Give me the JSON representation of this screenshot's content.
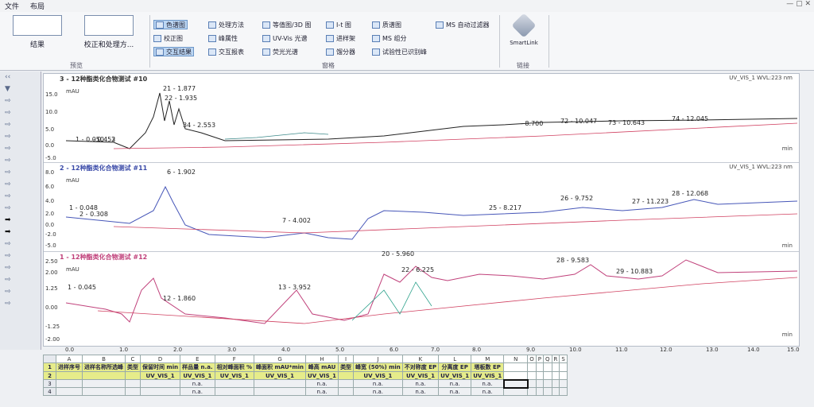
{
  "menu": {
    "items": [
      "文件",
      "布局"
    ]
  },
  "ribbon": {
    "big_buttons": [
      {
        "label": "结果"
      },
      {
        "label": "校正和处理方..."
      }
    ],
    "view_group": [
      "色谱图",
      "校正图",
      "交互结果"
    ],
    "col2": [
      "处理方法",
      "峰属性",
      "交互报表"
    ],
    "col3": [
      "等值图/3D 图",
      "UV-Vis 光谱",
      "荧光光谱"
    ],
    "col4": [
      "I-t 图",
      "进样架",
      "馏分器"
    ],
    "col5": [
      "质谱图",
      "MS 组分",
      "试验性已识别峰"
    ],
    "col6": [
      "MS 自动过滤器"
    ],
    "smartlink": "SmartLink",
    "group_labels": [
      "预览",
      "窗格",
      "链接"
    ]
  },
  "panels": [
    {
      "title": "3 - 12种酯类化合物测试 #10",
      "wave": "UV_VIS_1 WVL:223 nm",
      "yticks": [
        "15.0",
        "10.0",
        "5.0",
        "0.0",
        "-5.0"
      ],
      "unit": "mAU",
      "min": "min",
      "peaks": [
        "1 - 0.050",
        "- 0.452",
        "3",
        "21 - 1.877",
        "22 - 1.935",
        "34 - 2.553",
        "- 8.700",
        "72 - 10.047",
        "73 - 10.643",
        "74 - 12.045"
      ],
      "color": "#222"
    },
    {
      "title": "2 - 12种酯类化合物测试 #11",
      "wave": "UV_VIS_1 WVL:223 nm",
      "yticks": [
        "8.0",
        "6.0",
        "4.0",
        "2.0",
        "0.0",
        "-2.0",
        "-5.0"
      ],
      "unit": "mAU",
      "min": "min",
      "peaks": [
        "6 - 1.902",
        "1 - 0.048",
        "2 - 0.308",
        "7 - 4.002",
        "25 - 8.217",
        "26 - 9.752",
        "27 - 11.223",
        "28 - 12.068"
      ],
      "color": "#4656b8"
    },
    {
      "title": "1 - 12种酯类化合物测试 #12",
      "wave": "",
      "yticks": [
        "2.50",
        "2.00",
        "1.25",
        "0.00",
        "-1.25",
        "-2.00"
      ],
      "unit": "mAU",
      "min": "min",
      "peaks": [
        "1 - 0.045",
        "13 - 3.952",
        "12 - 1.860",
        "20 - 5.960",
        "22 - 6.225",
        "28 - 9.583",
        "29 - 10.883"
      ],
      "color": "#c0407a"
    }
  ],
  "xaxis": {
    "ticks": [
      "0.0",
      "1.0",
      "2.0",
      "3.0",
      "4.0",
      "5.0",
      "6.0",
      "7.0",
      "8.0",
      "9.0",
      "10.0",
      "11.0",
      "12.0",
      "13.0",
      "14.0",
      "15.0"
    ]
  },
  "table": {
    "col_letters": [
      "A",
      "B",
      "C",
      "D",
      "E",
      "F",
      "G",
      "H",
      "I",
      "J",
      "K",
      "L",
      "M",
      "N",
      "O",
      "P",
      "Q",
      "R",
      "S"
    ],
    "headers": [
      "进样序号",
      "进样名称所选峰",
      "类型",
      "保留时间 min",
      "样品量 n.a.",
      "相对峰面积 %",
      "峰面积 mAU*min",
      "峰高 mAU",
      "类型",
      "峰宽 (50%) min",
      "不对称度 EP",
      "分离度 EP",
      "塔板数 EP"
    ],
    "units": [
      "",
      "",
      "",
      "UV_VIS_1",
      "UV_VIS_1",
      "UV_VIS_1",
      "UV_VIS_1",
      "UV_VIS_1",
      "",
      "UV_VIS_1",
      "UV_VIS_1",
      "UV_VIS_1",
      "UV_VIS_1"
    ],
    "row3": [
      "",
      "",
      "",
      "",
      "n.a.",
      "",
      "",
      "n.a.",
      "",
      "n.a.",
      "n.a.",
      "n.a.",
      "n.a."
    ],
    "row4": [
      "",
      "",
      "",
      "",
      "n.a.",
      "",
      "",
      "n.a.",
      "",
      "n.a.",
      "n.a.",
      "n.a.",
      "n.a."
    ],
    "row_numbers": [
      "1",
      "2",
      "3",
      "4"
    ]
  }
}
